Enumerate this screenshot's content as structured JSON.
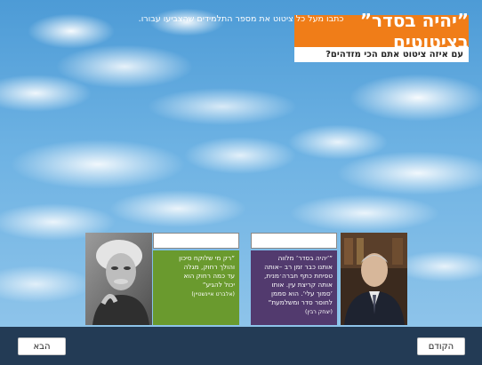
{
  "header": {
    "title": "”יהיה בסדר” בציטוטים",
    "subtitle": "עם איזה ציטוט אתם הכי מזדהים?"
  },
  "cards": [
    {
      "id": "einstein",
      "photo_icon": "einstein-portrait",
      "quote_lines": [
        "”רק מי שלוקח סיכון",
        "והולך רחוק, מגלה",
        "עד כמה רחוק הוא",
        "יכול להגיע”"
      ],
      "author": "(אלברט איינשטיין)",
      "answer_value": "",
      "color": "#6a9a2e"
    },
    {
      "id": "rabin",
      "photo_icon": "rabin-portrait",
      "quote_lines": [
        "”’יהיה בסדר’ מלווה",
        "אותנו כבר זמן רב –אותה",
        "טפיחת כתף חברה׳מנית,",
        "אותה קריצת עין. אותו",
        "’סמוך עלי’. הוא סממן",
        "לחוסר סדר ומשלמעת”"
      ],
      "author": "(יצחק רבין)",
      "answer_value": "",
      "color": "#523a6e"
    }
  ],
  "footer": {
    "instruction": "כתבו מעל כל ציטוט את מספר התלמידים שהצביעו עבורו.",
    "next_label": "הבא",
    "prev_label": "הקודם",
    "background": "#233b55"
  }
}
